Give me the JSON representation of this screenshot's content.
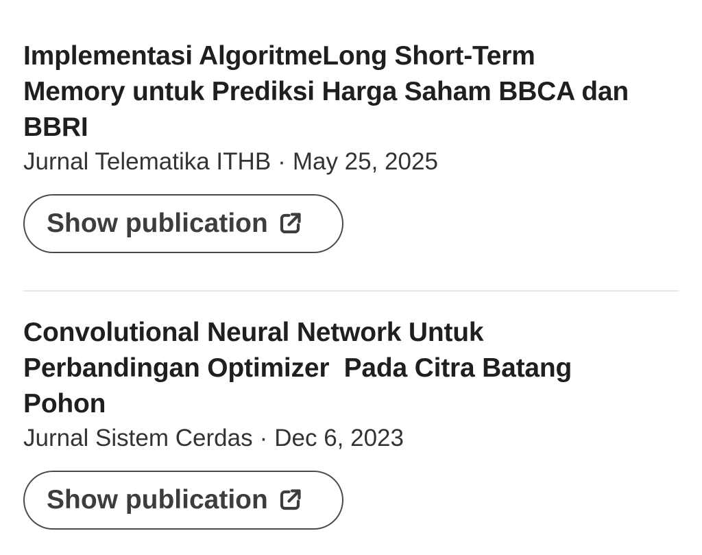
{
  "publications": [
    {
      "title": "Implementasi AlgoritmeLong Short-Term Memory untuk Prediksi Harga Saham BBCA dan BBRI",
      "journal": "Jurnal Telematika ITHB",
      "separator": "·",
      "date": "May 25, 2025",
      "button_label": "Show publication",
      "button_icon": "external-link-icon"
    },
    {
      "title": "Convolutional Neural Network Untuk Perbandingan Optimizer  Pada Citra Batang Pohon",
      "journal": "Jurnal Sistem Cerdas",
      "separator": "·",
      "date": "Dec 6, 2023",
      "button_label": "Show publication",
      "button_icon": "external-link-icon"
    }
  ],
  "colors": {
    "title": "#1f1f1f",
    "meta": "#333333",
    "button_border": "#4a4a4a",
    "button_text": "#3d3d3d",
    "divider": "#e8e8e8",
    "background": "#ffffff"
  }
}
